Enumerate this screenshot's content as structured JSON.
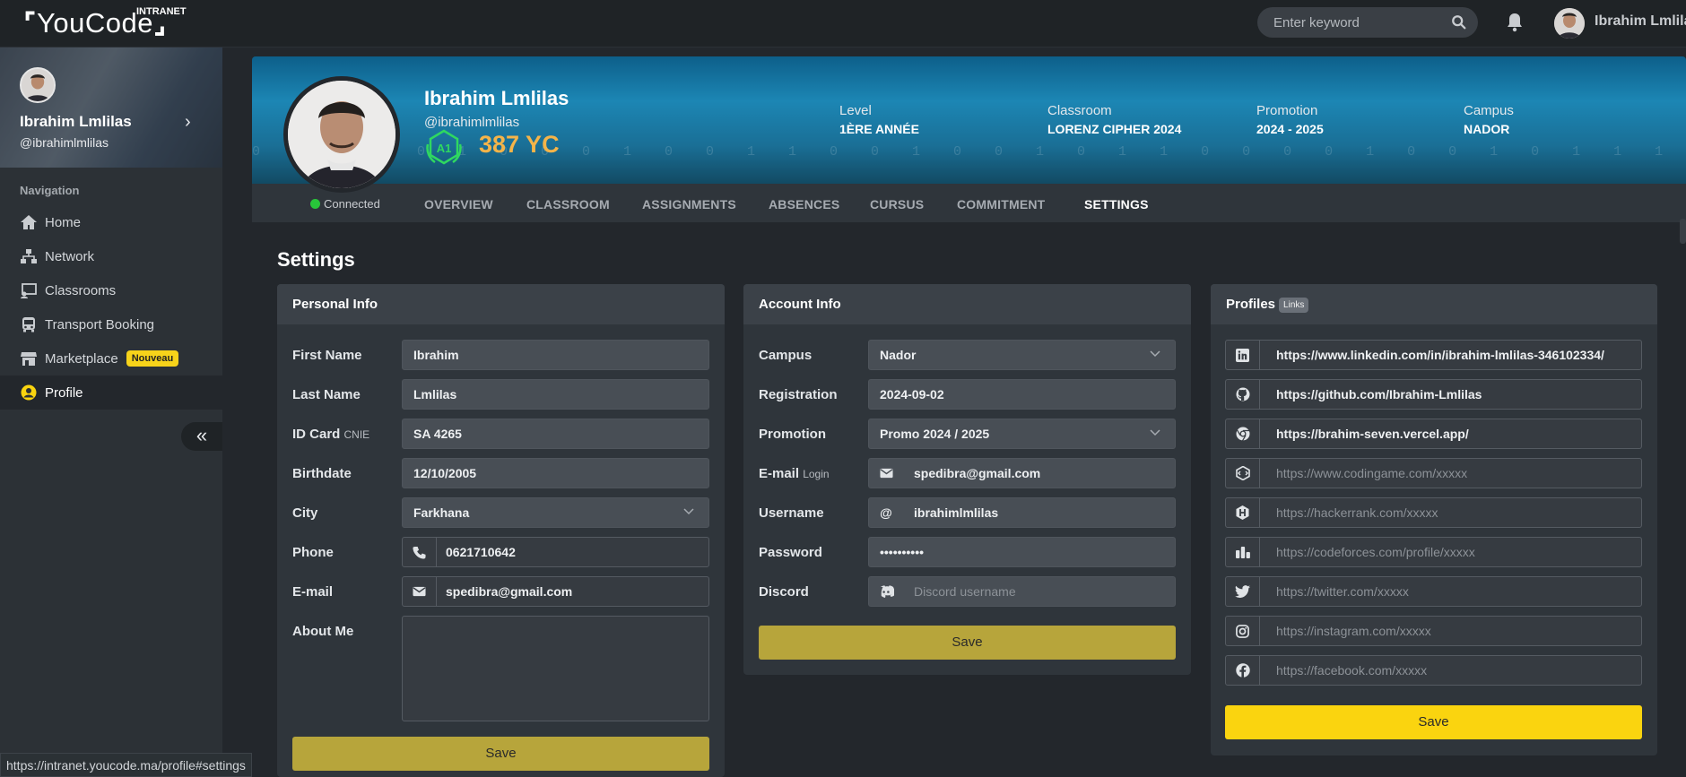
{
  "topbar": {
    "logo_text": "YouCode",
    "logo_sub": "INTRANET",
    "search_placeholder": "Enter keyword",
    "user_name": "Ibrahim Lmlilas"
  },
  "sidebar": {
    "name": "Ibrahim Lmlilas",
    "handle": "@ibrahimlmlilas",
    "nav_title": "Navigation",
    "items": [
      {
        "label": "Home",
        "icon": "home-icon"
      },
      {
        "label": "Network",
        "icon": "network-icon"
      },
      {
        "label": "Classrooms",
        "icon": "classroom-icon"
      },
      {
        "label": "Transport Booking",
        "icon": "bus-icon"
      },
      {
        "label": "Marketplace",
        "icon": "store-icon",
        "badge": "Nouveau"
      },
      {
        "label": "Profile",
        "icon": "user-circle-icon",
        "active": true
      }
    ],
    "collapse_glyph": "«"
  },
  "hero": {
    "name": "Ibrahim Lmlilas",
    "handle": "@ibrahimlmlilas",
    "level_badge": "A1",
    "yc": "387 YC",
    "connected": "Connected",
    "digits": "0 0 1 0 0 1 0 0 0 1 0 0 1 1 0 0 1 0 0 1 0 1 1 0 0 0 0 1 0 0 1 0 1 1 1 0 1 0 0 1 0 0 0 1 0 0 1 1 0 1 0 0 1",
    "stats": [
      {
        "label": "Level",
        "value": "1ÈRE ANNÉE"
      },
      {
        "label": "Classroom",
        "value": "LORENZ CIPHER 2024"
      },
      {
        "label": "Promotion",
        "value": "2024 - 2025"
      },
      {
        "label": "Campus",
        "value": "NADOR"
      }
    ],
    "tabs": [
      "OVERVIEW",
      "CLASSROOM",
      "ASSIGNMENTS",
      "ABSENCES",
      "CURSUS",
      "COMMITMENT",
      "SETTINGS"
    ]
  },
  "page_title": "Settings",
  "personal": {
    "title": "Personal Info",
    "first_name_label": "First Name",
    "first_name": "Ibrahim",
    "last_name_label": "Last Name",
    "last_name": "Lmlilas",
    "id_label": "ID Card",
    "id_sub": "CNIE",
    "id_value": "SA 4265",
    "birth_label": "Birthdate",
    "birth": "12/10/2005",
    "city_label": "City",
    "city": "Farkhana",
    "phone_label": "Phone",
    "phone": "0621710642",
    "email_label": "E-mail",
    "email": "spedibra@gmail.com",
    "about_label": "About Me",
    "save": "Save"
  },
  "account": {
    "title": "Account Info",
    "campus_label": "Campus",
    "campus": "Nador",
    "reg_label": "Registration",
    "reg": "2024-09-02",
    "promo_label": "Promotion",
    "promo": "Promo 2024 / 2025",
    "email_label": "E-mail",
    "email_sub": "Login",
    "email": "spedibra@gmail.com",
    "user_label": "Username",
    "user_prefix": "@",
    "user": "ibrahimlmlilas",
    "pass_label": "Password",
    "pass": "••••••••••",
    "discord_label": "Discord",
    "discord_placeholder": "Discord username",
    "save": "Save"
  },
  "profiles": {
    "title": "Profiles",
    "badge": "Links",
    "links": [
      {
        "icon": "linkedin-icon",
        "value": "https://www.linkedin.com/in/ibrahim-lmlilas-346102334/",
        "placeholder": ""
      },
      {
        "icon": "github-icon",
        "value": "https://github.com/Ibrahim-Lmlilas",
        "placeholder": ""
      },
      {
        "icon": "chrome-icon",
        "value": "https://brahim-seven.vercel.app/",
        "placeholder": ""
      },
      {
        "icon": "codingame-icon",
        "value": "",
        "placeholder": "https://www.codingame.com/xxxxx"
      },
      {
        "icon": "hackerrank-icon",
        "value": "",
        "placeholder": "https://hackerrank.com/xxxxx"
      },
      {
        "icon": "codeforces-icon",
        "value": "",
        "placeholder": "https://codeforces.com/profile/xxxxx"
      },
      {
        "icon": "twitter-icon",
        "value": "",
        "placeholder": "https://twitter.com/xxxxx"
      },
      {
        "icon": "instagram-icon",
        "value": "",
        "placeholder": "https://instagram.com/xxxxx"
      },
      {
        "icon": "facebook-icon",
        "value": "",
        "placeholder": "https://facebook.com/xxxxx"
      }
    ],
    "save": "Save"
  },
  "status_url": "https://intranet.youcode.ma/profile#settings",
  "colors": {
    "accent_yellow": "#fad40f",
    "olive": "#b7a53b",
    "yc_orange": "#f4b449",
    "online_green": "#28c63a"
  }
}
